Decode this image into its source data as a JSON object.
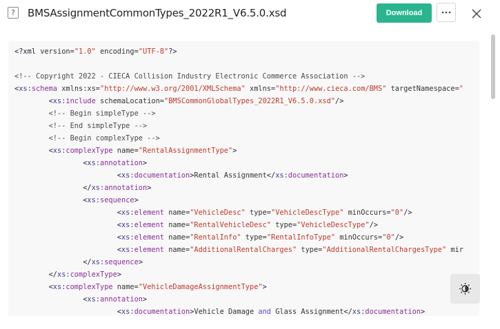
{
  "header": {
    "file_icon_glyph": "?",
    "file_name": "BMSAssignmentCommonTypes_2022R1_V6.5.0.xsd",
    "download_label": "Download",
    "more_icon": "ellipsis-icon",
    "close_icon": "close-icon"
  },
  "colors": {
    "accent": "#2bb58e",
    "string_value": "#c0392b",
    "element_name": "#8b2c9b"
  },
  "code": {
    "lines": [
      [
        [
          "t-tag",
          "<?xml "
        ],
        [
          "t-attr",
          "version="
        ],
        [
          "t-val",
          "\"1.0\""
        ],
        [
          "t-attr",
          " encoding="
        ],
        [
          "t-val",
          "\"UTF-8\""
        ],
        [
          "t-tag",
          "?>"
        ]
      ],
      [],
      [
        [
          "t-com",
          "<!-- Copyright 2022 - CIECA Collision Industry Electronic Commerce Association -->"
        ]
      ],
      [
        [
          "t-tag",
          "<"
        ],
        [
          "t-ns",
          "xs:"
        ],
        [
          "t-el",
          "schema"
        ],
        [
          "t-attr",
          " xmlns:xs="
        ],
        [
          "t-val",
          "\"http://www.w3.org/2001/XMLSchema\""
        ],
        [
          "t-attr",
          " xmlns="
        ],
        [
          "t-val",
          "\"http://www.cieca.com/BMS\""
        ],
        [
          "t-attr",
          " targetNamespace="
        ],
        [
          "t-val",
          "\""
        ]
      ],
      [
        [
          "t-tag",
          "        <"
        ],
        [
          "t-ns",
          "xs:"
        ],
        [
          "t-el",
          "include"
        ],
        [
          "t-attr",
          " schemaLocation="
        ],
        [
          "t-val",
          "\"BMSCommonGlobalTypes_2022R1_V6.5.0.xsd\""
        ],
        [
          "t-tag",
          "/>"
        ]
      ],
      [
        [
          "t-com",
          "        <!-- Begin simpleType -->"
        ]
      ],
      [
        [
          "t-com",
          "        <!-- End simpleType -->"
        ]
      ],
      [
        [
          "t-com",
          "        <!-- Begin complexType -->"
        ]
      ],
      [
        [
          "t-tag",
          "        <"
        ],
        [
          "t-ns",
          "xs:"
        ],
        [
          "t-el",
          "complexType"
        ],
        [
          "t-attr",
          " name="
        ],
        [
          "t-val",
          "\"RentalAssignmentType\""
        ],
        [
          "t-tag",
          ">"
        ]
      ],
      [
        [
          "t-tag",
          "                <"
        ],
        [
          "t-ns",
          "xs:"
        ],
        [
          "t-el",
          "annotation"
        ],
        [
          "t-tag",
          ">"
        ]
      ],
      [
        [
          "t-tag",
          "                        <"
        ],
        [
          "t-ns",
          "xs:"
        ],
        [
          "t-el",
          "documentation"
        ],
        [
          "t-tag",
          ">"
        ],
        [
          "t-attr",
          "Rental Assignment"
        ],
        [
          "t-tag",
          "</"
        ],
        [
          "t-ns",
          "xs:"
        ],
        [
          "t-el",
          "documentation"
        ],
        [
          "t-tag",
          ">"
        ]
      ],
      [
        [
          "t-tag",
          "                </"
        ],
        [
          "t-ns",
          "xs:"
        ],
        [
          "t-el",
          "annotation"
        ],
        [
          "t-tag",
          ">"
        ]
      ],
      [
        [
          "t-tag",
          "                <"
        ],
        [
          "t-ns",
          "xs:"
        ],
        [
          "t-el",
          "sequence"
        ],
        [
          "t-tag",
          ">"
        ]
      ],
      [
        [
          "t-tag",
          "                        <"
        ],
        [
          "t-ns",
          "xs:"
        ],
        [
          "t-el",
          "element"
        ],
        [
          "t-attr",
          " name="
        ],
        [
          "t-val",
          "\"VehicleDesc\""
        ],
        [
          "t-attr",
          " type="
        ],
        [
          "t-val",
          "\"VehicleDescType\""
        ],
        [
          "t-attr",
          " minOccurs="
        ],
        [
          "t-val",
          "\"0\""
        ],
        [
          "t-tag",
          "/>"
        ]
      ],
      [
        [
          "t-tag",
          "                        <"
        ],
        [
          "t-ns",
          "xs:"
        ],
        [
          "t-el",
          "element"
        ],
        [
          "t-attr",
          " name="
        ],
        [
          "t-val",
          "\"RentalVehicleDesc\""
        ],
        [
          "t-attr",
          " type="
        ],
        [
          "t-val",
          "\"VehicleDescType\""
        ],
        [
          "t-tag",
          "/>"
        ]
      ],
      [
        [
          "t-tag",
          "                        <"
        ],
        [
          "t-ns",
          "xs:"
        ],
        [
          "t-el",
          "element"
        ],
        [
          "t-attr",
          " name="
        ],
        [
          "t-val",
          "\"RentalInfo\""
        ],
        [
          "t-attr",
          " type="
        ],
        [
          "t-val",
          "\"RentalInfoType\""
        ],
        [
          "t-attr",
          " minOccurs="
        ],
        [
          "t-val",
          "\"0\""
        ],
        [
          "t-tag",
          "/>"
        ]
      ],
      [
        [
          "t-tag",
          "                        <"
        ],
        [
          "t-ns",
          "xs:"
        ],
        [
          "t-el",
          "element"
        ],
        [
          "t-attr",
          " name="
        ],
        [
          "t-val",
          "\"AdditionalRentalCharges\""
        ],
        [
          "t-attr",
          " type="
        ],
        [
          "t-val",
          "\"AdditionalRentalChargesType\""
        ],
        [
          "t-attr",
          " mir"
        ]
      ],
      [
        [
          "t-tag",
          "                </"
        ],
        [
          "t-ns",
          "xs:"
        ],
        [
          "t-el",
          "sequence"
        ],
        [
          "t-tag",
          ">"
        ]
      ],
      [
        [
          "t-tag",
          "        </"
        ],
        [
          "t-ns",
          "xs:"
        ],
        [
          "t-el",
          "complexType"
        ],
        [
          "t-tag",
          ">"
        ]
      ],
      [
        [
          "t-tag",
          "        <"
        ],
        [
          "t-ns",
          "xs:"
        ],
        [
          "t-el",
          "complexType"
        ],
        [
          "t-attr",
          " name="
        ],
        [
          "t-val",
          "\"VehicleDamageAssignmentType\""
        ],
        [
          "t-tag",
          ">"
        ]
      ],
      [
        [
          "t-tag",
          "                <"
        ],
        [
          "t-ns",
          "xs:"
        ],
        [
          "t-el",
          "annotation"
        ],
        [
          "t-tag",
          ">"
        ]
      ],
      [
        [
          "t-tag",
          "                        <"
        ],
        [
          "t-ns",
          "xs:"
        ],
        [
          "t-el",
          "documentation"
        ],
        [
          "t-tag",
          ">"
        ],
        [
          "t-attr",
          "Vehicle Damage "
        ],
        [
          "t-kw",
          "and"
        ],
        [
          "t-attr",
          " Glass Assignment"
        ],
        [
          "t-tag",
          "</"
        ],
        [
          "t-ns",
          "xs:"
        ],
        [
          "t-el",
          "documentation"
        ],
        [
          "t-tag",
          ">"
        ]
      ]
    ]
  },
  "floating_action": {
    "icon": "theme-toggle-icon"
  }
}
